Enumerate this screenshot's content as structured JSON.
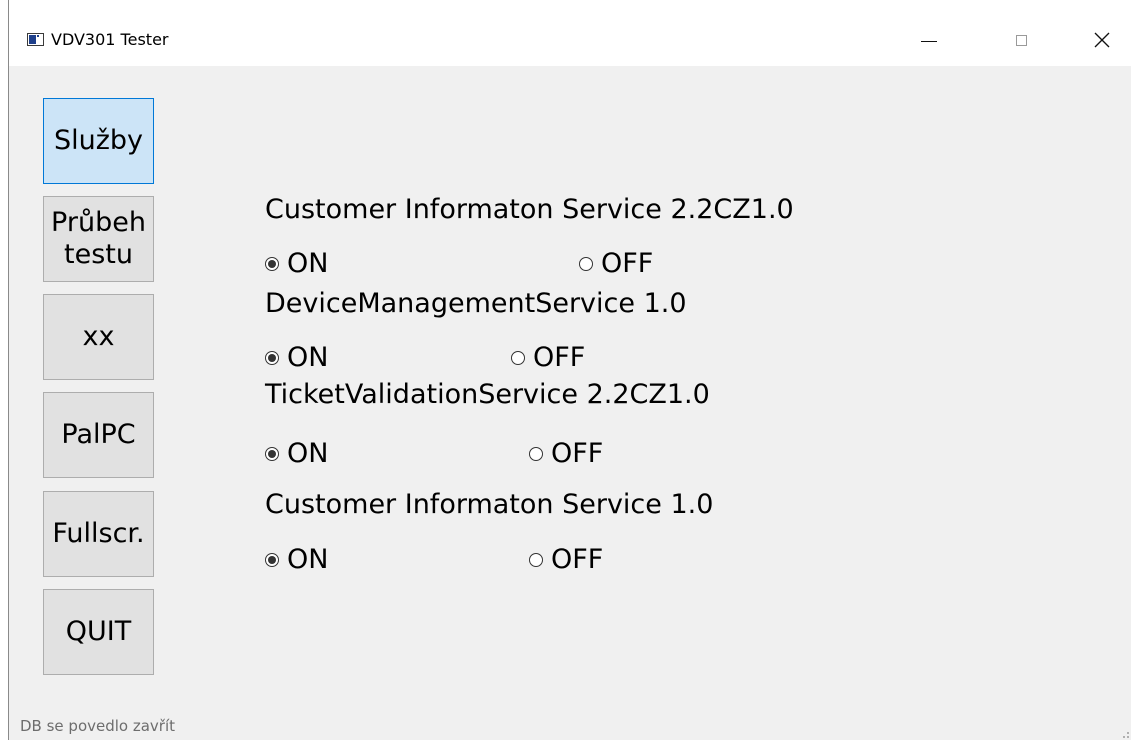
{
  "window": {
    "title": "VDV301 Tester",
    "controls": {
      "minimize": "—",
      "maximize": "□",
      "close": "✕"
    }
  },
  "nav": [
    {
      "id": "sluzby",
      "label": "Služby",
      "active": true
    },
    {
      "id": "prubeh",
      "label": "Průbeh\ntestu",
      "active": false
    },
    {
      "id": "xx",
      "label": "xx",
      "active": false
    },
    {
      "id": "palpc",
      "label": "PalPC",
      "active": false
    },
    {
      "id": "fullscr",
      "label": "Fullscr.",
      "active": false
    },
    {
      "id": "quit",
      "label": "QUIT",
      "active": false
    }
  ],
  "services": [
    {
      "name": "Customer Informaton Service 2.2CZ1.0",
      "on_label": "ON",
      "off_label": "OFF",
      "selected": "on"
    },
    {
      "name": "DeviceManagementService 1.0",
      "on_label": "ON",
      "off_label": "OFF",
      "selected": "on"
    },
    {
      "name": "TicketValidationService 2.2CZ1.0",
      "on_label": "ON",
      "off_label": "OFF",
      "selected": "on"
    },
    {
      "name": "Customer Informaton Service 1.0",
      "on_label": "ON",
      "off_label": "OFF",
      "selected": "on"
    }
  ],
  "status_bar": {
    "message": "DB se povedlo zavřít"
  },
  "colors": {
    "window_bg": "#f0f0f0",
    "button_bg": "#e1e1e1",
    "button_active_bg": "#cce4f7",
    "button_active_border": "#0078d7",
    "status_text": "#6d6d6d"
  }
}
